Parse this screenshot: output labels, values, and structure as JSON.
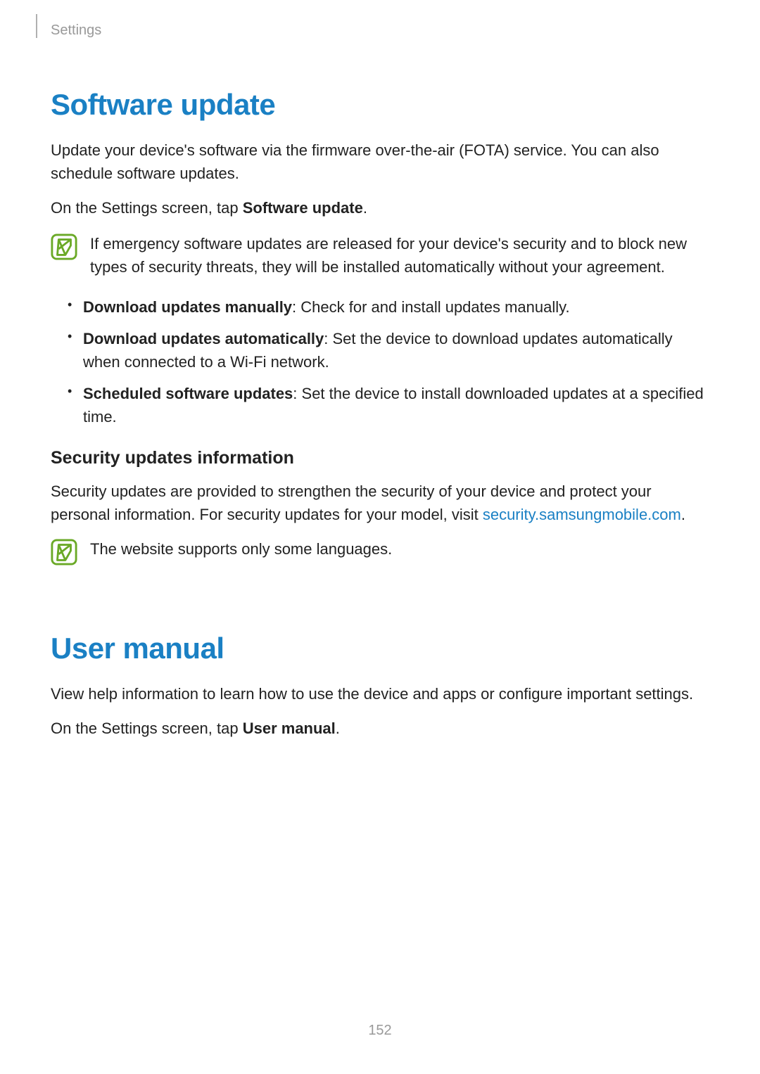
{
  "breadcrumb": "Settings",
  "section1": {
    "title": "Software update",
    "intro": "Update your device's software via the firmware over-the-air (FOTA) service. You can also schedule software updates.",
    "tap_prefix": "On the Settings screen, tap ",
    "tap_bold": "Software update",
    "tap_suffix": ".",
    "note": "If emergency software updates are released for your device's security and to block new types of security threats, they will be installed automatically without your agreement.",
    "bullets": [
      {
        "bold": "Download updates manually",
        "rest": ": Check for and install updates manually."
      },
      {
        "bold": "Download updates automatically",
        "rest": ": Set the device to download updates automatically when connected to a Wi-Fi network."
      },
      {
        "bold": "Scheduled software updates",
        "rest": ": Set the device to install downloaded updates at a specified time."
      }
    ],
    "sub_title": "Security updates information",
    "sub_body_prefix": "Security updates are provided to strengthen the security of your device and protect your personal information. For security updates for your model, visit ",
    "sub_body_link": "security.samsungmobile.com",
    "sub_body_suffix": ".",
    "note2": "The website supports only some languages."
  },
  "section2": {
    "title": "User manual",
    "intro": "View help information to learn how to use the device and apps or configure important settings.",
    "tap_prefix": "On the Settings screen, tap ",
    "tap_bold": "User manual",
    "tap_suffix": "."
  },
  "page_number": "152"
}
